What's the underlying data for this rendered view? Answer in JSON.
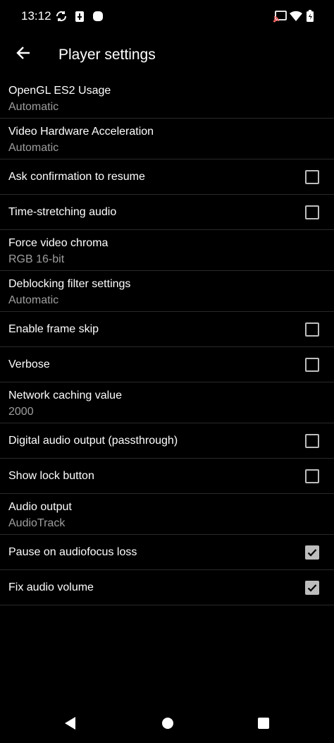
{
  "status": {
    "time": "13:12",
    "icons": [
      "sync-icon",
      "battery-saver-icon",
      "notification-dot-icon",
      "cast-icon",
      "wifi-icon",
      "battery-icon"
    ]
  },
  "header": {
    "title": "Player settings",
    "back_icon": "arrow-back-icon"
  },
  "settings": [
    {
      "title": "OpenGL ES2 Usage",
      "subtitle": "Automatic"
    },
    {
      "title": "Video Hardware Acceleration",
      "subtitle": "Automatic"
    },
    {
      "title": "Ask confirmation to resume",
      "checked": false
    },
    {
      "title": "Time-stretching audio",
      "checked": false
    },
    {
      "title": "Force video chroma",
      "subtitle": "RGB 16-bit"
    },
    {
      "title": "Deblocking filter settings",
      "subtitle": "Automatic"
    },
    {
      "title": "Enable frame skip",
      "checked": false
    },
    {
      "title": "Verbose",
      "checked": false
    },
    {
      "title": "Network caching value",
      "subtitle": "2000"
    },
    {
      "title": "Digital audio output (passthrough)",
      "checked": false
    },
    {
      "title": "Show lock button",
      "checked": false
    },
    {
      "title": "Audio output",
      "subtitle": "AudioTrack"
    },
    {
      "title": "Pause on audiofocus loss",
      "checked": true
    },
    {
      "title": "Fix audio volume",
      "checked": true
    }
  ],
  "navigation": {
    "icons": [
      "nav-back-icon",
      "nav-home-icon",
      "nav-recents-icon"
    ]
  },
  "colors": {
    "background": "#000000",
    "text_primary": "#ffffff",
    "text_secondary": "#9e9e9e",
    "divider": "#2a2a2a",
    "checkbox": "#bdbdbd"
  }
}
